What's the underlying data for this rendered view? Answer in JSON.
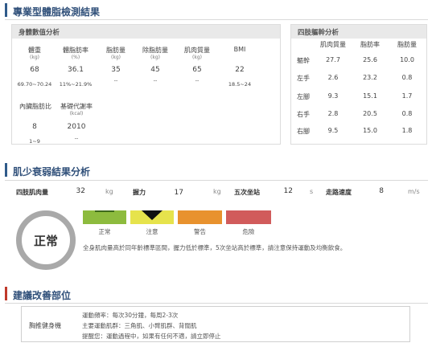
{
  "header": {
    "title": "專業型體脂檢測結果",
    "accent_color": "#2f5a8a"
  },
  "body_data": {
    "panel_title": "身體數值分析",
    "columns": [
      {
        "label": "體重",
        "unit": "(kg)",
        "value": "68",
        "range": "69.70~70.24"
      },
      {
        "label": "體脂肪率",
        "unit": "(%)",
        "value": "36.1",
        "range": "11%~21.9%"
      },
      {
        "label": "脂肪量",
        "unit": "(kg)",
        "value": "35",
        "range": "--"
      },
      {
        "label": "除脂肪量",
        "unit": "(kg)",
        "value": "45",
        "range": "--"
      },
      {
        "label": "肌肉質量",
        "unit": "(kg)",
        "value": "65",
        "range": "--"
      },
      {
        "label": "BMI",
        "unit": "",
        "value": "22",
        "range": "18.5~24"
      }
    ],
    "columns2": [
      {
        "label": "內臟脂肪比",
        "unit": "",
        "value": "8",
        "range": "1~9"
      },
      {
        "label": "基礎代謝率",
        "unit": "(kcal)",
        "value": "2010",
        "range": "--"
      }
    ]
  },
  "limbs": {
    "panel_title": "四肢軀幹分析",
    "headers": [
      "肌肉質量",
      "脂肪率",
      "脂肪量"
    ],
    "rows": [
      {
        "label": "軀幹",
        "muscle": "27.7",
        "fat_rate": "25.6",
        "fat_mass": "10.0"
      },
      {
        "label": "左手",
        "muscle": "2.6",
        "fat_rate": "23.2",
        "fat_mass": "0.8"
      },
      {
        "label": "左腳",
        "muscle": "9.3",
        "fat_rate": "15.1",
        "fat_mass": "1.7"
      },
      {
        "label": "右手",
        "muscle": "2.8",
        "fat_rate": "20.5",
        "fat_mass": "0.8"
      },
      {
        "label": "右腳",
        "muscle": "9.5",
        "fat_rate": "15.0",
        "fat_mass": "1.8"
      }
    ]
  },
  "sarcopenia": {
    "title": "肌少衰弱結果分析",
    "accent_color": "#2f5a8a",
    "metrics": [
      {
        "label": "四肢肌肉量",
        "value": "32",
        "unit": "kg"
      },
      {
        "label": "握力",
        "value": "17",
        "unit": "kg"
      },
      {
        "label": "五次坐站",
        "value": "12",
        "unit": "s"
      },
      {
        "label": "走路速度",
        "value": "8",
        "unit": "m/s"
      }
    ],
    "status": "正常",
    "levels": [
      {
        "label": "正常",
        "color": "#8dbb3e"
      },
      {
        "label": "注意",
        "color": "#e6e34c"
      },
      {
        "label": "警告",
        "color": "#e8922e"
      },
      {
        "label": "危險",
        "color": "#d15b5b"
      }
    ],
    "marker_level": "注意",
    "note": "全身肌肉量高於同年齡標準區間，握力低於標準，5次坐站高於標準，請注意保持運動及均衡飲食。"
  },
  "suggestion": {
    "title": "建議改善部位",
    "accent_color": "#c0392b",
    "area": "胸推健身機",
    "lines": [
      "運動頻率：每次30分鐘，每周2-3次",
      "主要運動肌群：三角肌、小臂肌群、背闊肌",
      "提醒您：運動過程中，如果有任何不適，請立即停止"
    ]
  }
}
